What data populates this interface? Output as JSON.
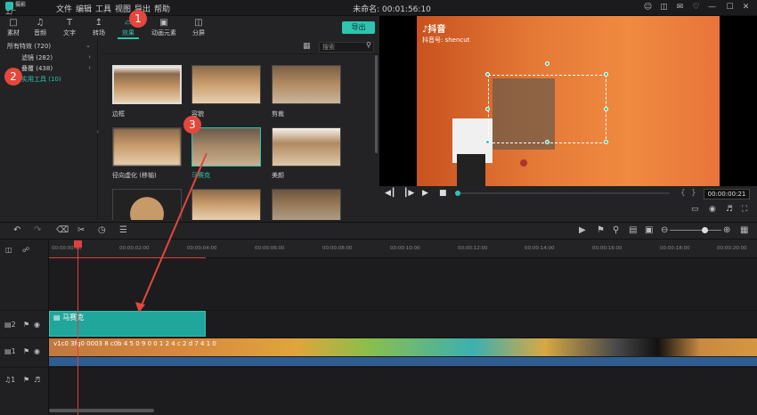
{
  "app": {
    "logo_text": "摄影工厂",
    "title": "未命名: 00:01:56:10"
  },
  "menu": [
    "文件",
    "编辑",
    "工具",
    "视图",
    "导出",
    "帮助"
  ],
  "tabs": [
    {
      "label": "素材",
      "icon": "folder-icon"
    },
    {
      "label": "音频",
      "icon": "music-icon"
    },
    {
      "label": "文字",
      "icon": "text-icon"
    },
    {
      "label": "转场",
      "icon": "transition-icon"
    },
    {
      "label": "效果",
      "icon": "effects-icon",
      "active": true
    },
    {
      "label": "动画元素",
      "icon": "image-icon"
    },
    {
      "label": "分屏",
      "icon": "split-screen-icon"
    }
  ],
  "export_label": "导出",
  "categories": [
    {
      "label": "所有特效 (720)"
    },
    {
      "label": "滤镜 (282)"
    },
    {
      "label": "叠覆 (438)"
    },
    {
      "label": "实用工具 (10)"
    }
  ],
  "search": {
    "placeholder": "搜索"
  },
  "effects": [
    {
      "label": "边框"
    },
    {
      "label": "容貌"
    },
    {
      "label": "剪裁"
    },
    {
      "label": "径向虚化 (移轴)"
    },
    {
      "label": "马赛克"
    },
    {
      "label": "美颜"
    }
  ],
  "preview": {
    "brand": "抖音",
    "account": "抖音号: shencut",
    "timecode": "00:00:00:21"
  },
  "ruler": [
    "00:00:00:00",
    "00:00:02:00",
    "00:00:04:00",
    "00:00:06:00",
    "00:00:08:00",
    "00:00:10:00",
    "00:00:12:00",
    "00:00:14:00",
    "00:00:16:00",
    "00:00:18:00",
    "00:00:20:00"
  ],
  "tracks": {
    "effect_clip": "马赛克",
    "video_clip": "v1c0 3fg0 0003 8 c0b 4 5 0 9 0 0 1 2 4 c 2 d 7 4 1 0",
    "track2": "2",
    "track1": "1",
    "audio": "1"
  },
  "badges": [
    "1",
    "2",
    "3"
  ],
  "colors": {
    "accent": "#2ec4b0",
    "badge": "#e4473c"
  }
}
